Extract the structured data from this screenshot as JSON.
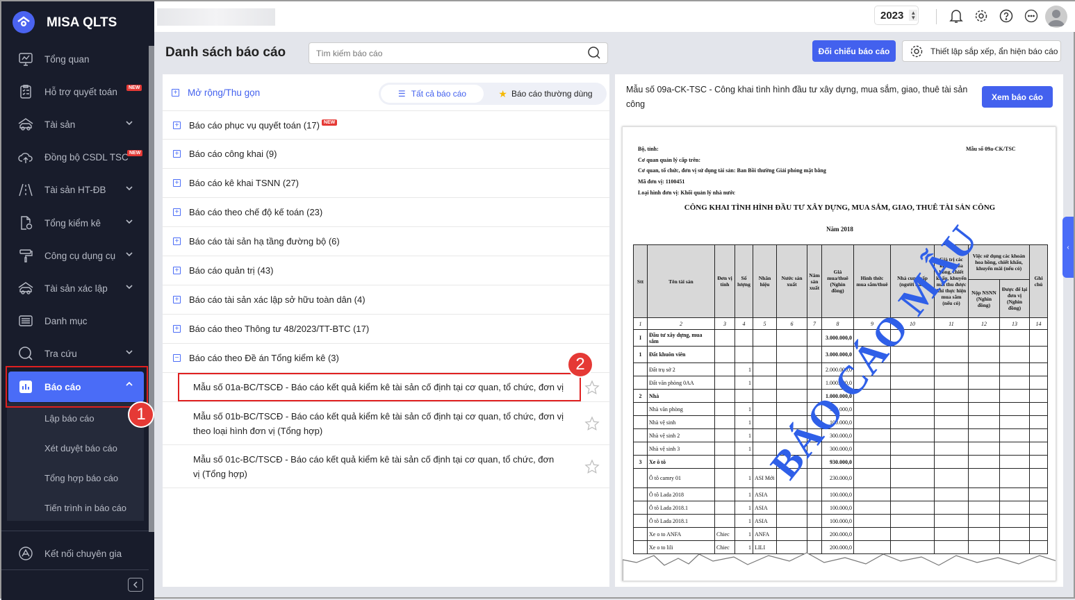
{
  "app": {
    "name": "MISA QLTS"
  },
  "sidebar": {
    "items": [
      {
        "label": "Tổng quan",
        "icon": "monitor-chart-icon"
      },
      {
        "label": "Hỗ trợ quyết toán",
        "icon": "clipboard-icon",
        "badge": "NEW"
      },
      {
        "label": "Tài sản",
        "icon": "house-car-icon"
      },
      {
        "label": "Đồng bộ CSDL TSC",
        "icon": "cloud-upload-icon",
        "badge": "NEW"
      },
      {
        "label": "Tài sản HT-ĐB",
        "icon": "road-icon"
      },
      {
        "label": "Tổng kiểm kê",
        "icon": "file-check-icon"
      },
      {
        "label": "Công cụ dụng cụ",
        "icon": "paint-roller-icon"
      },
      {
        "label": "Tài sản xác lập",
        "icon": "house-car-icon"
      },
      {
        "label": "Danh mục",
        "icon": "list-icon"
      },
      {
        "label": "Tra cứu",
        "icon": "search-icon"
      },
      {
        "label": "Báo cáo",
        "icon": "bar-chart-icon"
      }
    ],
    "sub_items": [
      "Lập báo cáo",
      "Xét duyệt báo cáo",
      "Tổng hợp báo cáo",
      "Tiến trình in báo cáo"
    ],
    "bottom": "Kết nối chuyên gia",
    "callout_1": "1"
  },
  "topbar": {
    "year": "2023"
  },
  "page": {
    "title": "Danh sách báo cáo",
    "search_placeholder": "Tìm kiếm báo cáo",
    "compare_button": "Đối chiếu báo cáo",
    "settings_button": "Thiết lập sắp xếp, ẩn hiện báo cáo"
  },
  "list": {
    "expand": "Mở rộng/Thu gọn",
    "tab_all": "Tất cả báo cáo",
    "tab_fav": "Báo cáo thường dùng",
    "groups": [
      "Báo cáo phục vụ quyết toán (17)",
      "Báo cáo công khai (9)",
      "Báo cáo kê khai TSNN (27)",
      "Báo cáo theo chế độ kế toán (23)",
      "Báo cáo tài sản hạ tầng đường bộ (6)",
      "Báo cáo quản trị (43)",
      "Báo cáo tài sản xác lập sở hữu toàn dân (4)",
      "Báo cáo theo Thông tư 48/2023/TT-BTC (17)",
      "Báo cáo theo Đề án Tổng kiểm kê (3)"
    ],
    "new_badge": "NEW",
    "reports": [
      "Mẫu số 01a-BC/TSCĐ - Báo cáo kết quả kiểm kê tài sản cố định tại cơ quan, tổ chức, đơn vị",
      "Mẫu số 01b-BC/TSCĐ - Báo cáo kết quả kiểm kê tài sản cố định tại cơ quan, tổ chức, đơn vị theo loại hình đơn vị (Tổng hợp)",
      "Mẫu số 01c-BC/TSCĐ - Báo cáo kết quả kiểm kê tài sản cố định tại cơ quan, tổ chức, đơn vị (Tổng hợp)"
    ],
    "callout_2": "2"
  },
  "preview": {
    "heading": "Mẫu số 09a-CK-TSC - Công khai tình hình đầu tư xây dựng, mua sắm, giao, thuê tài sản công",
    "view_button": "Xem báo cáo",
    "doc": {
      "lines": [
        "Bộ, tỉnh:",
        "Cơ quan quản lý cấp trên:",
        "Cơ quan, tổ chức, đơn vị sử dụng tài sản: Ban Bồi thường Giải phóng mặt bằng",
        "Mã đơn vị: 1100451",
        "Loại hình đơn vị: Khối quản lý nhà nước"
      ],
      "form_no": "Mẫu số 09a-CK/TSC",
      "title": "CÔNG KHAI TÌNH HÌNH ĐẦU TƯ XÂY DỰNG, MUA SẮM, GIAO, THUÊ TÀI SẢN CÔNG",
      "year": "Năm 2018",
      "watermark": "BÁO CÁO MẪU",
      "headers": [
        "Stt",
        "Tên tài sản",
        "Đơn vị tính",
        "Số lượng",
        "Nhãn hiệu",
        "Nước sản xuất",
        "Năm sản xuất",
        "Giá mua/thuê (Nghìn đồng)",
        "Hình thức mua sắm/thuê",
        "Nhà cung cấp (người bán)",
        "Giá trị các khoản hoa hồng, chiết khấu, khuyến mãi thu được khi thực hiện mua sắm (nếu có)",
        "Nộp NSNN (Nghìn đồng)",
        "Được để lại đơn vị (Nghìn đồng)",
        "Ghi chú"
      ],
      "group_header": "Việc sử dụng các khoản hoa hồng, chiết khấu, khuyến mãi (nếu có)",
      "numbers": [
        "1",
        "2",
        "3",
        "4",
        "5",
        "6",
        "7",
        "8",
        "9",
        "10",
        "11",
        "12",
        "13",
        "14"
      ],
      "rows": [
        {
          "stt": "I",
          "name": "Đầu tư xây dựng, mua sắm",
          "unit": "",
          "qty": "",
          "brand": "",
          "price": "3.000.000,0",
          "bold": true
        },
        {
          "stt": "1",
          "name": "Đất khuôn viên",
          "unit": "",
          "qty": "",
          "brand": "",
          "price": "3.000.000,0",
          "bold": true
        },
        {
          "stt": "",
          "name": "Đất trụ sở 2",
          "unit": "",
          "qty": "1",
          "brand": "",
          "price": "2.000.000,0"
        },
        {
          "stt": "",
          "name": "Đất văn phòng 0AA",
          "unit": "",
          "qty": "1",
          "brand": "",
          "price": "1.000.000,0"
        },
        {
          "stt": "2",
          "name": "Nhà",
          "unit": "",
          "qty": "",
          "brand": "",
          "price": "1.000.000,0",
          "bold": true
        },
        {
          "stt": "",
          "name": "Nhà văn phòng",
          "unit": "",
          "qty": "1",
          "brand": "",
          "price": "300.000,0"
        },
        {
          "stt": "",
          "name": "Nhà vệ sinh",
          "unit": "",
          "qty": "1",
          "brand": "",
          "price": "100.000,0"
        },
        {
          "stt": "",
          "name": "Nhà vệ sinh 2",
          "unit": "",
          "qty": "1",
          "brand": "",
          "price": "300.000,0"
        },
        {
          "stt": "",
          "name": "Nhà vệ sinh 3",
          "unit": "",
          "qty": "1",
          "brand": "",
          "price": "300.000,0"
        },
        {
          "stt": "3",
          "name": "Xe ô tô",
          "unit": "",
          "qty": "",
          "brand": "",
          "price": "930.000,0",
          "bold": true
        },
        {
          "stt": "",
          "name": "Ô tô camry 01",
          "unit": "",
          "qty": "1",
          "brand": "ASI Mới",
          "price": "230.000,0"
        },
        {
          "stt": "",
          "name": "Ô tô Lada 2018",
          "unit": "",
          "qty": "1",
          "brand": "ASIA",
          "price": "100.000,0"
        },
        {
          "stt": "",
          "name": "Ô tô Lada 2018.1",
          "unit": "",
          "qty": "1",
          "brand": "ASIA",
          "price": "100.000,0"
        },
        {
          "stt": "",
          "name": "Ô tô Lada 2018.1",
          "unit": "",
          "qty": "1",
          "brand": "ASIA",
          "price": "100.000,0"
        },
        {
          "stt": "",
          "name": "Xe o to ANFA",
          "unit": "Chiec",
          "qty": "1",
          "brand": "ANFA",
          "price": "200.000,0"
        },
        {
          "stt": "",
          "name": "Xe o to lili",
          "unit": "Chiec",
          "qty": "1",
          "brand": "LILI",
          "price": "200.000,0"
        }
      ]
    }
  },
  "colors": {
    "accent": "#4361ee",
    "sidebar": "#181c2b",
    "callout": "#e53935"
  }
}
